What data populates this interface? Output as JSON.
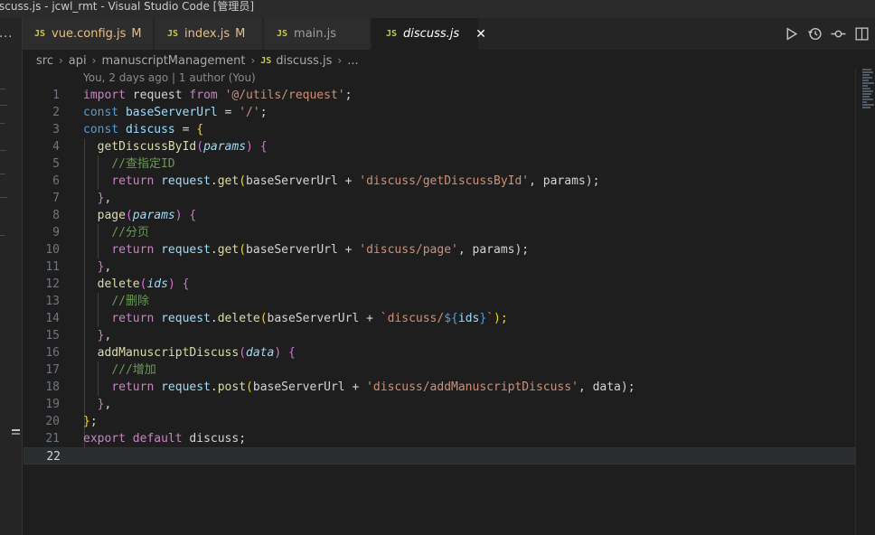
{
  "window": {
    "title": "scuss.js - jcwl_rmt - Visual Studio Code [管理员]"
  },
  "left_strip": {
    "more_icon": "ellipsis-icon"
  },
  "tabs": [
    {
      "label": "vue.config.js",
      "badge": "M",
      "icon": "JS"
    },
    {
      "label": "index.js",
      "badge": "M",
      "icon": "JS"
    },
    {
      "label": "main.js",
      "badge": "",
      "icon": "JS"
    },
    {
      "label": "discuss.js",
      "badge": "",
      "icon": "JS",
      "close": "✕"
    }
  ],
  "actions": [
    "run-icon",
    "history-icon",
    "source-control-icon"
  ],
  "breadcrumb": {
    "parts": [
      "src",
      "api",
      "manuscriptManagement"
    ],
    "file_icon": "JS",
    "file": "discuss.js",
    "more": "..."
  },
  "blame": "You, 2 days ago | 1 author (You)",
  "code": {
    "line_numbers": [
      "1",
      "2",
      "3",
      "4",
      "5",
      "6",
      "7",
      "8",
      "9",
      "10",
      "11",
      "12",
      "13",
      "14",
      "15",
      "16",
      "17",
      "18",
      "19",
      "20",
      "21",
      "22"
    ],
    "current_line": 22,
    "lines": [
      [
        "import",
        " request ",
        "from",
        " ",
        "'@/utils/request'",
        ";"
      ],
      [
        "const",
        " ",
        "baseServerUrl",
        " = ",
        "'/'",
        ";"
      ],
      [
        "const",
        " ",
        "discuss",
        " = ",
        "{"
      ],
      [
        "  ",
        "getDiscussById",
        "(",
        "params",
        ")",
        " ",
        "{"
      ],
      [
        "    ",
        "//查指定ID"
      ],
      [
        "    ",
        "return",
        " ",
        "request",
        ".",
        "get",
        "(",
        "baseServerUrl + ",
        "'discuss/getDiscussById'",
        ", params);"
      ],
      [
        "  ",
        "}",
        ","
      ],
      [
        "  ",
        "page",
        "(",
        "params",
        ")",
        " ",
        "{"
      ],
      [
        "    ",
        "//分页"
      ],
      [
        "    ",
        "return",
        " ",
        "request",
        ".",
        "get",
        "(",
        "baseServerUrl + ",
        "'discuss/page'",
        ", params);"
      ],
      [
        "  ",
        "}",
        ","
      ],
      [
        "  ",
        "delete",
        "(",
        "ids",
        ")",
        " ",
        "{"
      ],
      [
        "    ",
        "//删除"
      ],
      [
        "    ",
        "return",
        " ",
        "request",
        ".",
        "delete",
        "(",
        "baseServerUrl + ",
        "`discuss/",
        "${",
        "ids",
        "}",
        "`",
        ");"
      ],
      [
        "  ",
        "}",
        ","
      ],
      [
        "  ",
        "addManuscriptDiscuss",
        "(",
        "data",
        ")",
        " ",
        "{"
      ],
      [
        "    ",
        "///增加"
      ],
      [
        "    ",
        "return",
        " ",
        "request",
        ".",
        "post",
        "(",
        "baseServerUrl + ",
        "'discuss/addManuscriptDiscuss'",
        ", data);"
      ],
      [
        "  ",
        "}",
        ","
      ],
      [
        "}",
        ";"
      ],
      [
        "export",
        " ",
        "default",
        " discuss;"
      ],
      [
        ""
      ]
    ]
  },
  "colors": {
    "background": "#1e1e1e",
    "tab_bar": "#252526",
    "keyword": "#569cd6",
    "string": "#ce9178",
    "function": "#dcdcaa",
    "comment": "#6a9955",
    "modified": "#e2c08d"
  }
}
